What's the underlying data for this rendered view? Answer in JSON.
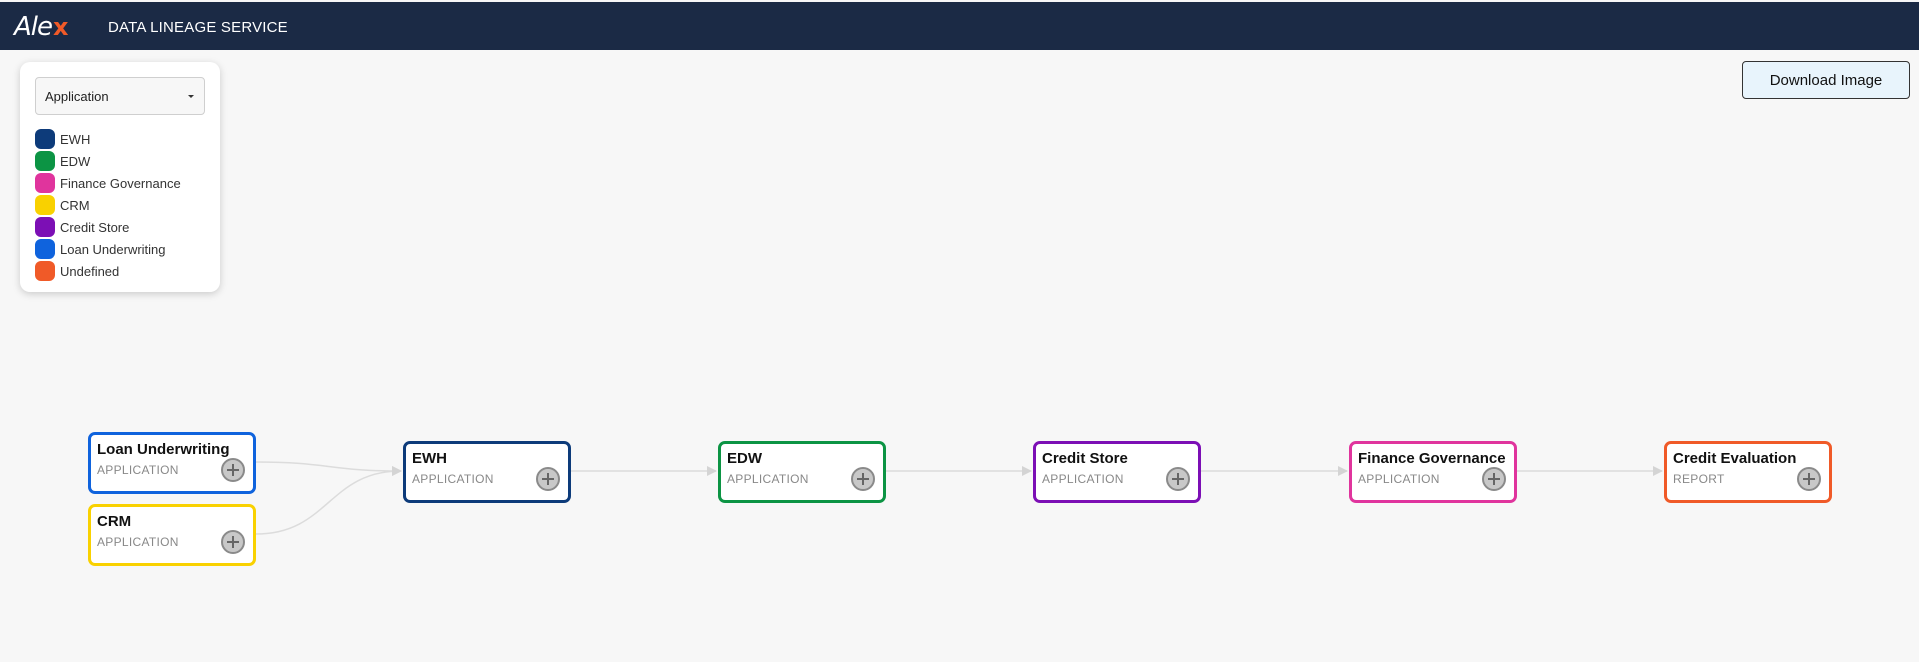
{
  "header": {
    "logo_text": "Ale",
    "logo_accent": "x",
    "title": "DATA LINEAGE SERVICE"
  },
  "legend": {
    "selector": {
      "selected": "Application"
    },
    "items": [
      {
        "label": "EWH",
        "color": "#0d3b7a"
      },
      {
        "label": "EDW",
        "color": "#0c9444"
      },
      {
        "label": "Finance Governance",
        "color": "#e0349d"
      },
      {
        "label": "CRM",
        "color": "#f9d100"
      },
      {
        "label": "Credit Store",
        "color": "#7c0fb5"
      },
      {
        "label": "Loan Underwriting",
        "color": "#0f63dd"
      },
      {
        "label": "Undefined",
        "color": "#f05a28"
      }
    ]
  },
  "toolbar": {
    "download_label": "Download Image"
  },
  "graph": {
    "nodes": [
      {
        "id": "loan",
        "name": "Loan Underwriting",
        "type": "APPLICATION",
        "color": "#0f63dd"
      },
      {
        "id": "crm",
        "name": "CRM",
        "type": "APPLICATION",
        "color": "#f9d100"
      },
      {
        "id": "ewh",
        "name": "EWH",
        "type": "APPLICATION",
        "color": "#0d3b7a"
      },
      {
        "id": "edw",
        "name": "EDW",
        "type": "APPLICATION",
        "color": "#0c9444"
      },
      {
        "id": "cs",
        "name": "Credit Store",
        "type": "APPLICATION",
        "color": "#7c0fb5"
      },
      {
        "id": "fg",
        "name": "Finance Governance",
        "type": "APPLICATION",
        "color": "#e0349d"
      },
      {
        "id": "ce",
        "name": "Credit Evaluation",
        "type": "REPORT",
        "color": "#f05a28"
      }
    ],
    "edges": [
      {
        "from": "loan",
        "to": "ewh"
      },
      {
        "from": "crm",
        "to": "ewh"
      },
      {
        "from": "ewh",
        "to": "edw"
      },
      {
        "from": "edw",
        "to": "cs"
      },
      {
        "from": "cs",
        "to": "fg"
      },
      {
        "from": "fg",
        "to": "ce"
      }
    ]
  }
}
